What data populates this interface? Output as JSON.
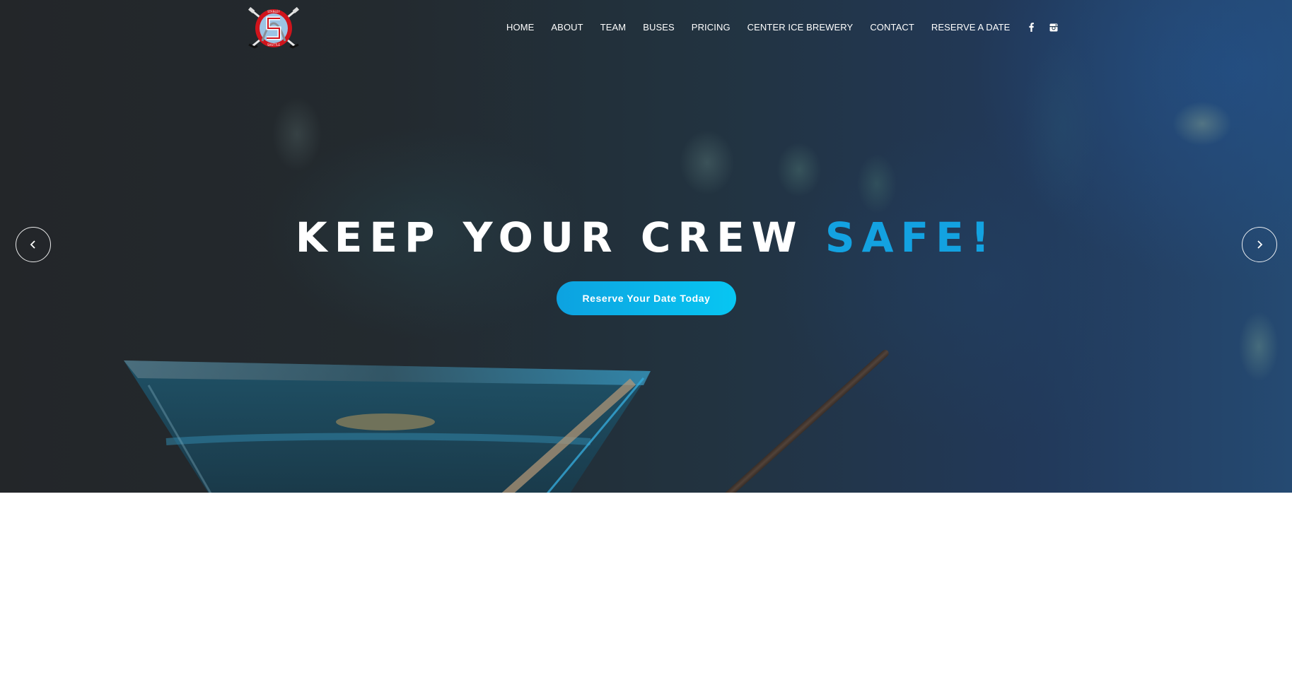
{
  "brand": {
    "name": "Stanley Shuttle",
    "logo_ring_top": "STANLEY",
    "logo_ring_bottom": "SHUTTLE",
    "logo_letter": "S",
    "colors": {
      "red": "#d0141c",
      "light_blue": "#9cc4e4",
      "white": "#ffffff"
    }
  },
  "nav": {
    "items": [
      {
        "label": "HOME"
      },
      {
        "label": "ABOUT"
      },
      {
        "label": "TEAM"
      },
      {
        "label": "BUSES"
      },
      {
        "label": "PRICING"
      },
      {
        "label": "CENTER ICE BREWERY"
      },
      {
        "label": "CONTACT"
      },
      {
        "label": "RESERVE A DATE"
      }
    ],
    "social": [
      {
        "icon": "facebook-icon",
        "glyph": "f"
      },
      {
        "icon": "instagram-icon",
        "glyph": ""
      }
    ]
  },
  "hero": {
    "headline_main": "KEEP YOUR CREW ",
    "headline_accent": "SAFE!",
    "cta_label": "Reserve Your Date Today",
    "prev_glyph": "‹",
    "next_glyph": "›",
    "colors": {
      "accent": "#13a2e1",
      "cta_start": "#0da2e0",
      "cta_end": "#07c6f2",
      "background_dark": "#232629",
      "background_blue": "#254a72"
    }
  }
}
